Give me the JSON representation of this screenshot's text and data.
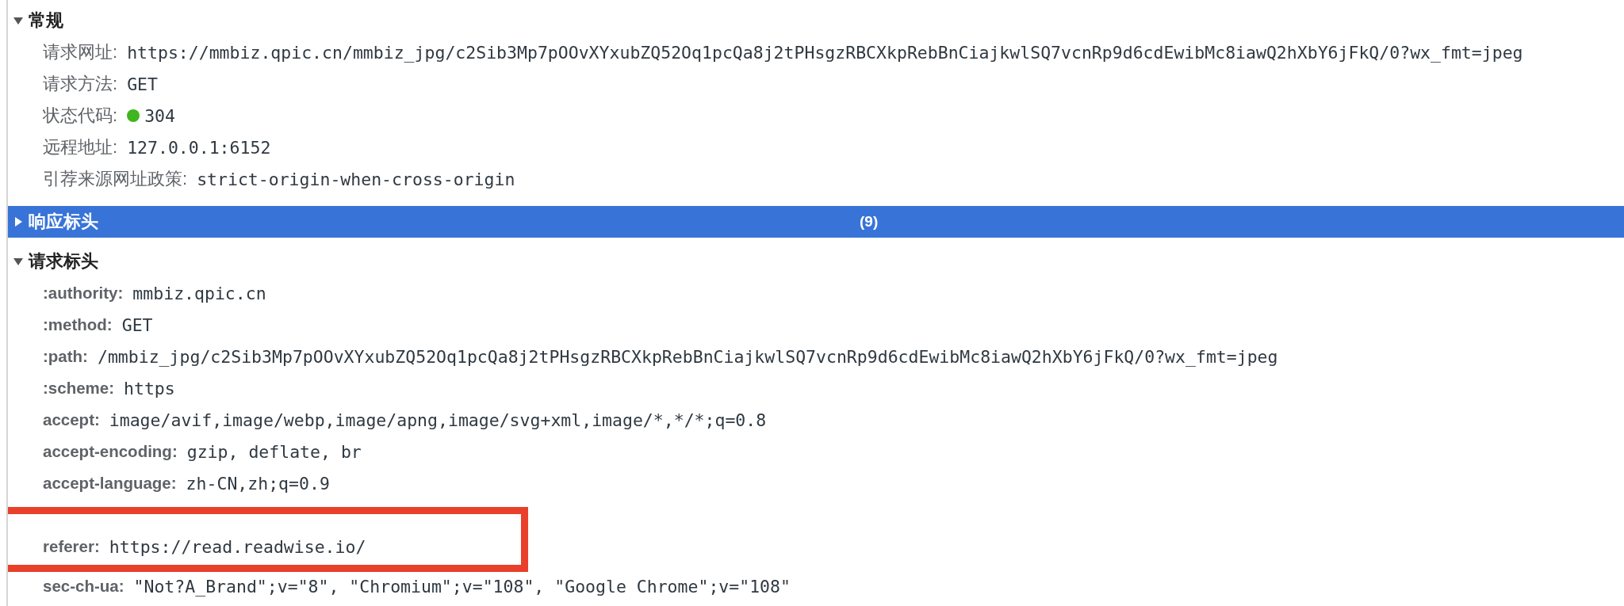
{
  "sections": [
    {
      "title": "常规",
      "expanded": true,
      "selected": false,
      "kind": "summary",
      "rows": [
        {
          "label": "请求网址:",
          "value": "https://mmbiz.qpic.cn/mmbiz_jpg/c2Sib3Mp7pOOvXYxubZQ52Oq1pcQa8j2tPHsgzRBCXkpRebBnCiajkwlSQ7vcnRp9d6cdEwibMc8iawQ2hXbY6jFkQ/0?wx_fmt=jpeg"
        },
        {
          "label": "请求方法:",
          "value": "GET"
        },
        {
          "label": "状态代码:",
          "value": "304",
          "color": "#3fb51f"
        },
        {
          "label": "远程地址:",
          "value": "127.0.0.1:6152"
        },
        {
          "label": "引荐来源网址政策:",
          "value": "strict-origin-when-cross-origin"
        }
      ]
    },
    {
      "title": "响应标头",
      "expanded": false,
      "selected": true,
      "count": "(9)"
    },
    {
      "title": "请求标头",
      "expanded": true,
      "selected": false,
      "kind": "headers",
      "rows": [
        {
          "label": ":authority:",
          "value": "mmbiz.qpic.cn"
        },
        {
          "label": ":method:",
          "value": "GET"
        },
        {
          "label": ":path:",
          "value": "/mmbiz_jpg/c2Sib3Mp7pOOvXYxubZQ52Oq1pcQa8j2tPHsgzRBCXkpRebBnCiajkwlSQ7vcnRp9d6cdEwibMc8iawQ2hXbY6jFkQ/0?wx_fmt=jpeg"
        },
        {
          "label": ":scheme:",
          "value": "https"
        },
        {
          "label": "accept:",
          "value": "image/avif,image/webp,image/apng,image/svg+xml,image/*,*/*;q=0.8"
        },
        {
          "label": "accept-encoding:",
          "value": "gzip, deflate, br"
        },
        {
          "label": "accept-language:",
          "value": "zh-CN,zh;q=0.9"
        },
        {
          "label": "referer:",
          "value": "https://read.readwise.io/",
          "outlined": true
        },
        {
          "label": "sec-ch-ua:",
          "value": "\"Not?A_Brand\";v=\"8\", \"Chromium\";v=\"108\", \"Google Chrome\";v=\"108\""
        }
      ]
    }
  ]
}
